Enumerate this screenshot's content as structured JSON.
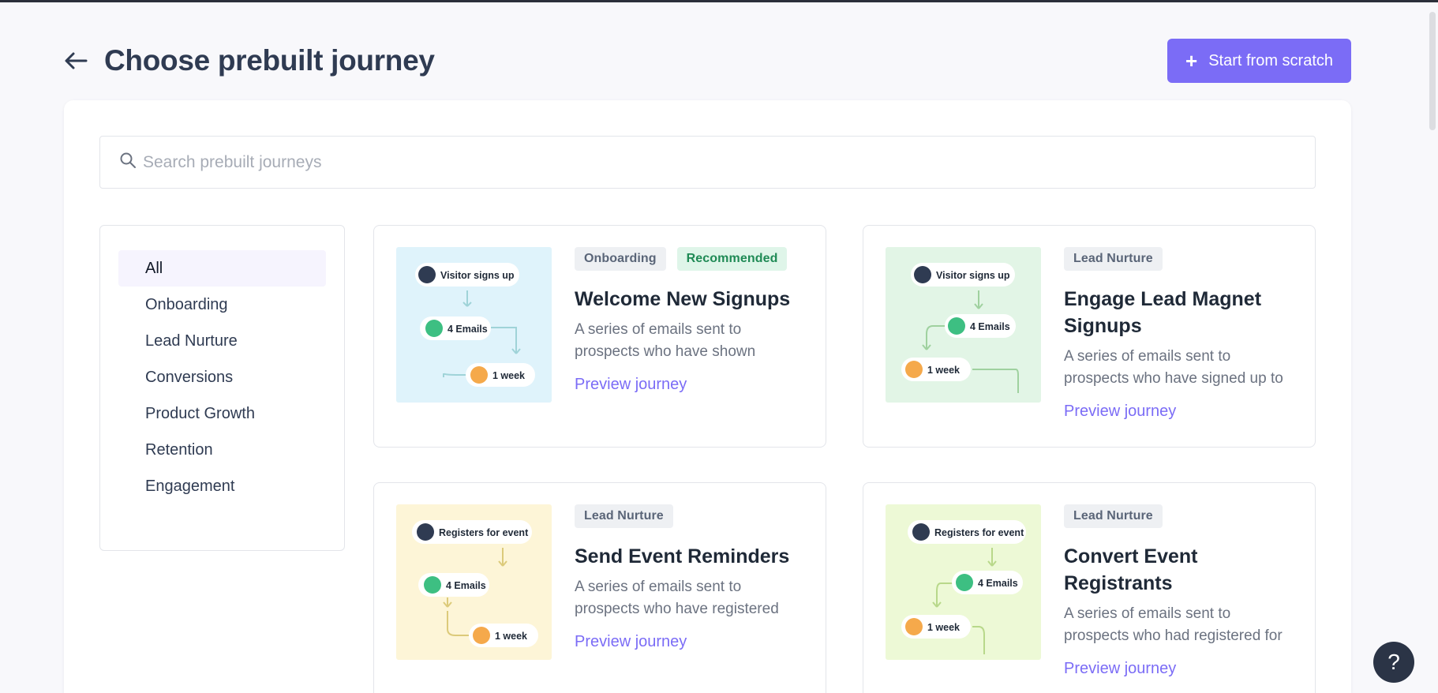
{
  "header": {
    "title": "Choose prebuilt journey",
    "start_label": "Start from scratch"
  },
  "search": {
    "placeholder": "Search prebuilt journeys"
  },
  "sidebar": {
    "items": [
      {
        "label": "All",
        "active": true
      },
      {
        "label": "Onboarding",
        "active": false
      },
      {
        "label": "Lead Nurture",
        "active": false
      },
      {
        "label": "Conversions",
        "active": false
      },
      {
        "label": "Product Growth",
        "active": false
      },
      {
        "label": "Retention",
        "active": false
      },
      {
        "label": "Engagement",
        "active": false
      }
    ]
  },
  "cards": [
    {
      "tags": [
        "Onboarding",
        "Recommended"
      ],
      "title": "Welcome New Signups",
      "description": "A series of emails sent to prospects who have shown",
      "link": "Preview journey",
      "thumb": {
        "trigger": "Visitor signs up",
        "emails": "4 Emails",
        "delay": "1 week",
        "bg": "#dff3fb"
      }
    },
    {
      "tags": [
        "Lead Nurture"
      ],
      "title": "Engage Lead Magnet Signups",
      "description": "A series of emails sent to prospects who have signed up to",
      "link": "Preview journey",
      "thumb": {
        "trigger": "Visitor signs up",
        "emails": "4 Emails",
        "delay": "1 week",
        "bg": "#e2f5e6"
      }
    },
    {
      "tags": [
        "Lead Nurture"
      ],
      "title": "Send Event Reminders",
      "description": "A series of emails sent to prospects who have registered",
      "link": "Preview journey",
      "thumb": {
        "trigger": "Registers for event",
        "emails": "4 Emails",
        "delay": "1 week",
        "bg": "#fdf5d7"
      }
    },
    {
      "tags": [
        "Lead Nurture"
      ],
      "title": "Convert Event Registrants",
      "description": "A series of emails sent to prospects who had registered for",
      "link": "Preview journey",
      "thumb": {
        "trigger": "Registers for event",
        "emails": "4 Emails",
        "delay": "1 week",
        "bg": "#edf9d6"
      }
    }
  ],
  "help": {
    "label": "?"
  },
  "colors": {
    "accent": "#7b6cf6",
    "title": "#2f3b52",
    "recommended": "#1f8a55"
  }
}
